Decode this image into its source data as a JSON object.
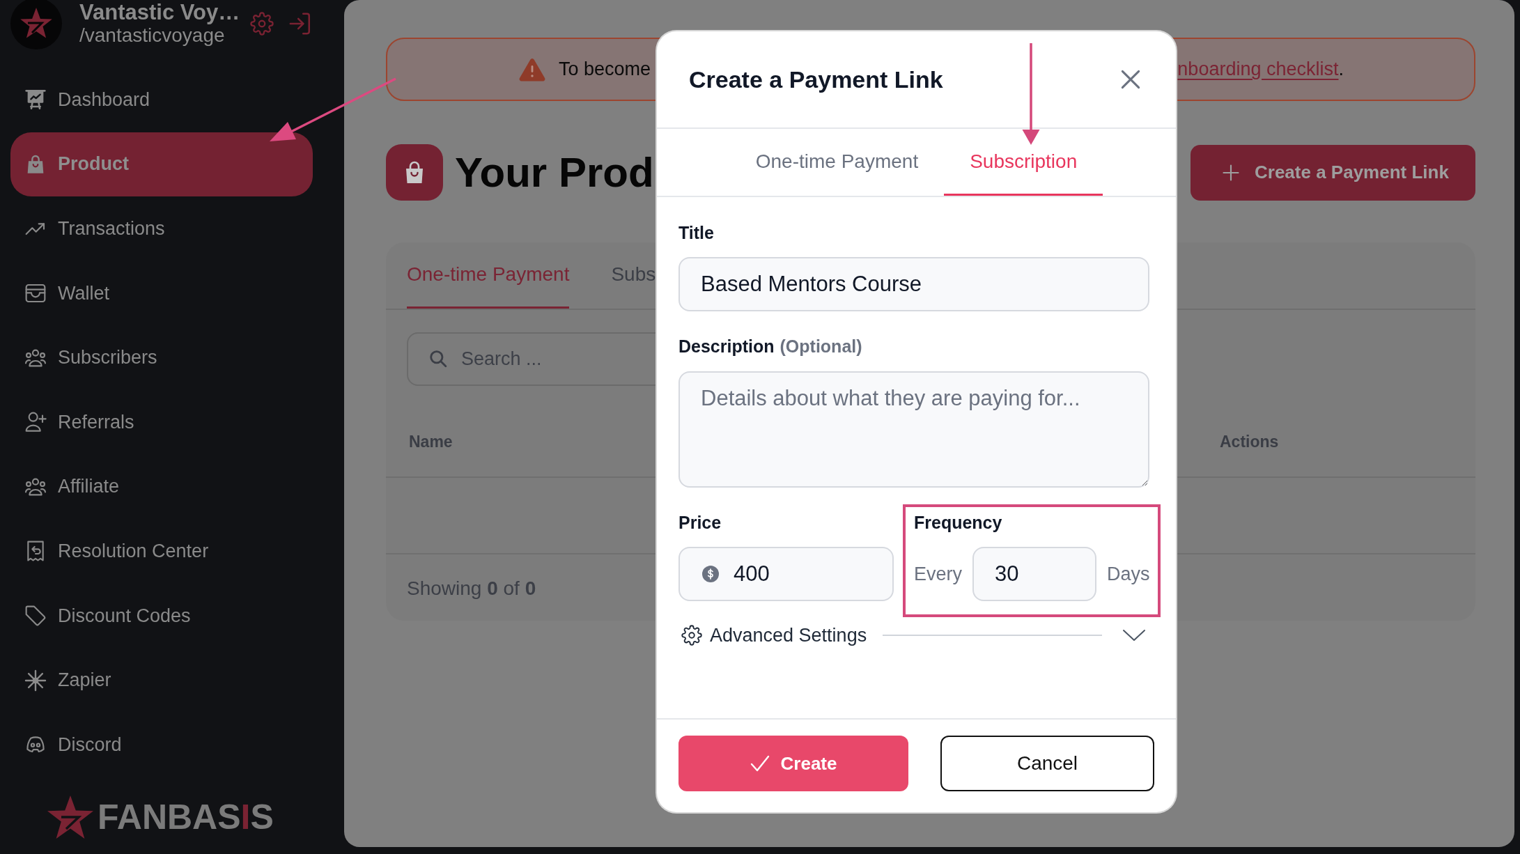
{
  "sidebar": {
    "account": {
      "name": "Vantastic Voy…",
      "handle": "/vantasticvoyage"
    },
    "items": [
      {
        "label": "Dashboard",
        "selected": false
      },
      {
        "label": "Product",
        "selected": true
      },
      {
        "label": "Transactions",
        "selected": false
      },
      {
        "label": "Wallet",
        "selected": false
      },
      {
        "label": "Subscribers",
        "selected": false
      },
      {
        "label": "Referrals",
        "selected": false
      },
      {
        "label": "Affiliate",
        "selected": false
      },
      {
        "label": "Resolution Center",
        "selected": false
      },
      {
        "label": "Discount Codes",
        "selected": false
      },
      {
        "label": "Zapier",
        "selected": false
      },
      {
        "label": "Discord",
        "selected": false
      }
    ],
    "logo": {
      "parts": [
        {
          "text": "FANBAS",
          "accent": false
        },
        {
          "text": "I",
          "accent": true
        },
        {
          "text": "S",
          "accent": false
        }
      ]
    }
  },
  "alert": {
    "text": "To become",
    "link": "nboarding checklist",
    "end": "."
  },
  "page": {
    "title": "Your Prod",
    "create_button": "Create a Payment Link"
  },
  "product_tabs": [
    {
      "label": "One-time Payment",
      "selected": true
    },
    {
      "label": "Subs",
      "selected": false
    }
  ],
  "search": {
    "placeholder": "Search ..."
  },
  "table": {
    "columns": [
      "Name",
      "Actions"
    ],
    "footer": "Showing **0** of **0**"
  },
  "dialog": {
    "title": "Create a Payment Link",
    "tabs": [
      {
        "label": "One-time Payment",
        "selected": false
      },
      {
        "label": "Subscription",
        "selected": true
      }
    ],
    "title_field": {
      "label": "Title",
      "value": "Based Mentors Course"
    },
    "description_field": {
      "label": "Description",
      "hint": "(Optional)",
      "placeholder": "Details about what they are paying for..."
    },
    "price_field": {
      "label": "Price",
      "value": "400"
    },
    "frequency_field": {
      "label": "Frequency",
      "prefix": "Every",
      "value": "30",
      "suffix": "Days"
    },
    "advanced_settings": {
      "label": "Advanced Settings",
      "expanded": false
    },
    "buttons": {
      "create": "Create",
      "cancel": "Cancel"
    }
  }
}
